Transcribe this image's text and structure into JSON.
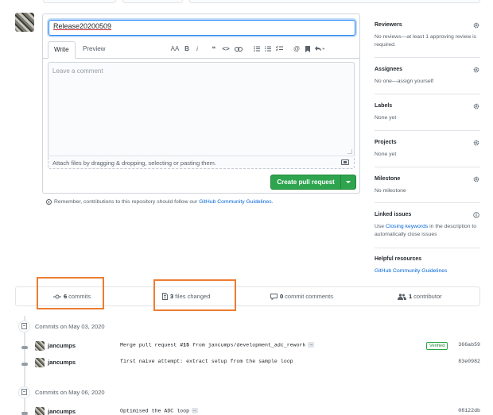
{
  "pr_form": {
    "title_value": "Release20200509",
    "tabs": {
      "write": "Write",
      "preview": "Preview"
    },
    "toolbar": {
      "heading": "AA",
      "bold": "B",
      "italic": "i",
      "quote": "❝",
      "code": "<>",
      "mention": "@"
    },
    "comment_placeholder": "Leave a comment",
    "attach_text": "Attach files by dragging & dropping, selecting or pasting them.",
    "create_button": "Create pull request",
    "remember_text": "Remember, contributions to this repository should follow our",
    "remember_link": "GitHub Community Guidelines."
  },
  "sidebar": {
    "reviewers": {
      "title": "Reviewers",
      "text": "No reviews—at least 1 approving review is required."
    },
    "assignees": {
      "title": "Assignees",
      "text": "No one—assign yourself"
    },
    "labels": {
      "title": "Labels",
      "text": "None yet"
    },
    "projects": {
      "title": "Projects",
      "text": "None yet"
    },
    "milestone": {
      "title": "Milestone",
      "text": "No milestone"
    },
    "linked_issues": {
      "title": "Linked issues",
      "text_before": "Use",
      "link": "Closing keywords",
      "text_after": "in the description to automatically close issues"
    },
    "helpful": {
      "title": "Helpful resources",
      "link": "GitHub Community Guidelines"
    }
  },
  "summary": {
    "commits_count": "6",
    "commits_label": "commits",
    "files_count": "3",
    "files_label": "files changed",
    "comments_count": "0",
    "comments_label": "commit comments",
    "contributors_count": "1",
    "contributors_label": "contributor"
  },
  "timeline": {
    "group1": {
      "heading": "Commits on May 03, 2020",
      "commits": [
        {
          "author": "jancumps",
          "msg_before": "Merge pull request ",
          "msg_bold": "#15",
          "msg_after": " from jancumps/development_adc_rework",
          "ellipsis": "…",
          "badge": "Verified",
          "sha": "366ab59"
        },
        {
          "author": "jancumps",
          "msg_before": "first naive attempt: extract setup from the sample loop",
          "sha": "83e0982"
        }
      ]
    },
    "group2": {
      "heading": "Commits on May 06, 2020",
      "commits": [
        {
          "author": "jancumps",
          "msg_before": "Optimised the ADC loop",
          "ellipsis": "…",
          "sha": "08122db"
        }
      ]
    }
  },
  "colors": {
    "primary_green": "#2ea44f",
    "link_blue": "#0366d6",
    "highlight_orange": "#ed7d31"
  }
}
